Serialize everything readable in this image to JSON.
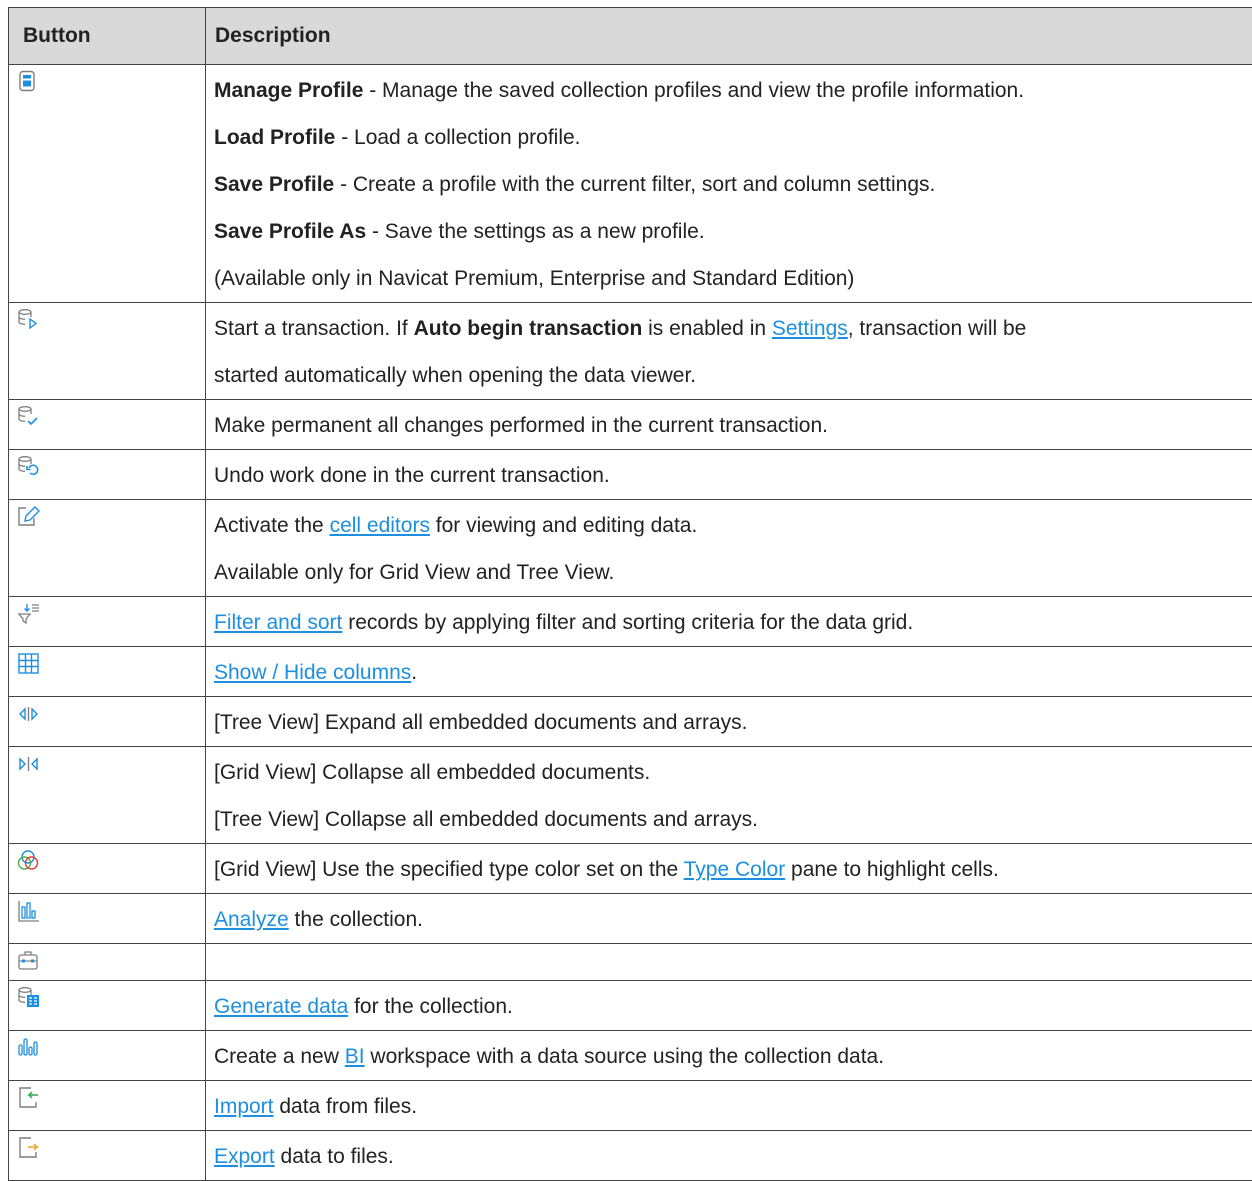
{
  "table": {
    "headers": {
      "button": "Button",
      "description": "Description"
    }
  },
  "rows": [
    {
      "icon": "profile-calculator-icon",
      "lines": [
        {
          "bold": "Manage Profile",
          "text": " - Manage the saved collection profiles and view the profile information."
        },
        {
          "bold": "Load Profile",
          "text": " - Load a collection profile."
        },
        {
          "bold": "Save Profile",
          "text": " - Create a profile with the current filter, sort and column settings."
        },
        {
          "bold": "Save Profile As",
          "text": " - Save the settings as a new profile."
        },
        {
          "text": "(Available only in Navicat Premium, Enterprise and Standard Edition)"
        }
      ]
    },
    {
      "icon": "begin-transaction-icon",
      "lines": [
        {
          "pre": "Start a transaction. If ",
          "bold": "Auto begin transaction",
          "mid": " is enabled in ",
          "link": "Settings",
          "post": ", transaction will be"
        },
        {
          "text": "started automatically when opening the data viewer."
        }
      ]
    },
    {
      "icon": "commit-icon",
      "lines": [
        {
          "text": "Make permanent all changes performed in the current transaction."
        }
      ]
    },
    {
      "icon": "rollback-icon",
      "lines": [
        {
          "text": "Undo work done in the current transaction."
        }
      ]
    },
    {
      "icon": "edit-icon",
      "lines": [
        {
          "pre": "Activate the ",
          "link": "cell editors",
          "post": " for viewing and editing data."
        },
        {
          "text": "Available only for Grid View and Tree View."
        }
      ]
    },
    {
      "icon": "filter-sort-icon",
      "lines": [
        {
          "link": "Filter and sort",
          "post": " records by applying filter and sorting criteria for the data grid."
        }
      ]
    },
    {
      "icon": "columns-icon",
      "lines": [
        {
          "link": "Show / Hide columns",
          "post": "."
        }
      ]
    },
    {
      "icon": "expand-all-icon",
      "lines": [
        {
          "text": "[Tree View] Expand all embedded documents and arrays."
        }
      ]
    },
    {
      "icon": "collapse-all-icon",
      "lines": [
        {
          "text": "[Grid View] Collapse all embedded documents."
        },
        {
          "text": "[Tree View] Collapse all embedded documents and arrays."
        }
      ]
    },
    {
      "icon": "type-color-icon",
      "lines": [
        {
          "pre": "[Grid View] Use the specified type color set on the ",
          "link": "Type Color",
          "post": " pane to highlight cells."
        }
      ]
    },
    {
      "icon": "analyze-icon",
      "lines": [
        {
          "link": "Analyze",
          "post": " the collection."
        }
      ]
    },
    {
      "icon": "toolbox-icon",
      "lines": []
    },
    {
      "icon": "generate-data-icon",
      "lines": [
        {
          "link": "Generate data",
          "post": " for the collection."
        }
      ]
    },
    {
      "icon": "bi-icon",
      "lines": [
        {
          "pre": "Create a new ",
          "link": "BI",
          "post": " workspace with a data source using the collection data."
        }
      ]
    },
    {
      "icon": "import-icon",
      "lines": [
        {
          "link": "Import",
          "post": " data from files."
        }
      ]
    },
    {
      "icon": "export-icon",
      "lines": [
        {
          "link": "Export",
          "post": " data to files."
        }
      ]
    }
  ],
  "colors": {
    "header_bg": "#d9d9d9",
    "link": "#1d8fe0",
    "icon_gray": "#7f7f7f",
    "icon_blue": "#1d8fe0"
  }
}
